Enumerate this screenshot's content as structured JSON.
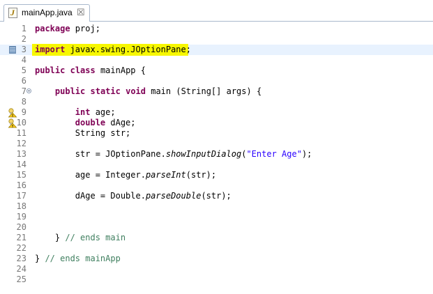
{
  "tab": {
    "title": "mainApp.java",
    "close_glyph": "☒"
  },
  "colors": {
    "keyword": "#7f0055",
    "string": "#2a00ff",
    "comment": "#3f7f5f",
    "highlight": "#f7f700"
  },
  "lines": [
    {
      "n": "1",
      "code": "package proj;"
    },
    {
      "n": "2",
      "code": ""
    },
    {
      "n": "3",
      "code": "import javax.swing.JOptionPane;"
    },
    {
      "n": "4",
      "code": ""
    },
    {
      "n": "5",
      "code": "public class mainApp {"
    },
    {
      "n": "6",
      "code": ""
    },
    {
      "n": "7",
      "code": "    public static void main (String[] args) {"
    },
    {
      "n": "8",
      "code": ""
    },
    {
      "n": "9",
      "code": "        int age;"
    },
    {
      "n": "10",
      "code": "        double dAge;"
    },
    {
      "n": "11",
      "code": "        String str;"
    },
    {
      "n": "12",
      "code": ""
    },
    {
      "n": "13",
      "code": "        str = JOptionPane.showInputDialog(\"Enter Age\");"
    },
    {
      "n": "14",
      "code": ""
    },
    {
      "n": "15",
      "code": "        age = Integer.parseInt(str);"
    },
    {
      "n": "16",
      "code": ""
    },
    {
      "n": "17",
      "code": "        dAge = Double.parseDouble(str);"
    },
    {
      "n": "18",
      "code": ""
    },
    {
      "n": "19",
      "code": ""
    },
    {
      "n": "20",
      "code": ""
    },
    {
      "n": "21",
      "code": "    } // ends main"
    },
    {
      "n": "22",
      "code": ""
    },
    {
      "n": "23",
      "code": "} // ends mainApp"
    },
    {
      "n": "24",
      "code": ""
    },
    {
      "n": "25",
      "code": ""
    }
  ],
  "current_line": "3",
  "highlighted_line": "3",
  "fold_line": "7",
  "warning_lines": [
    "9",
    "10"
  ],
  "marker_line": "3",
  "icons": {
    "file": "java-file-icon",
    "fold": "fold-collapse-icon",
    "warning": "warning-icon",
    "marker": "annotation-marker-icon"
  }
}
